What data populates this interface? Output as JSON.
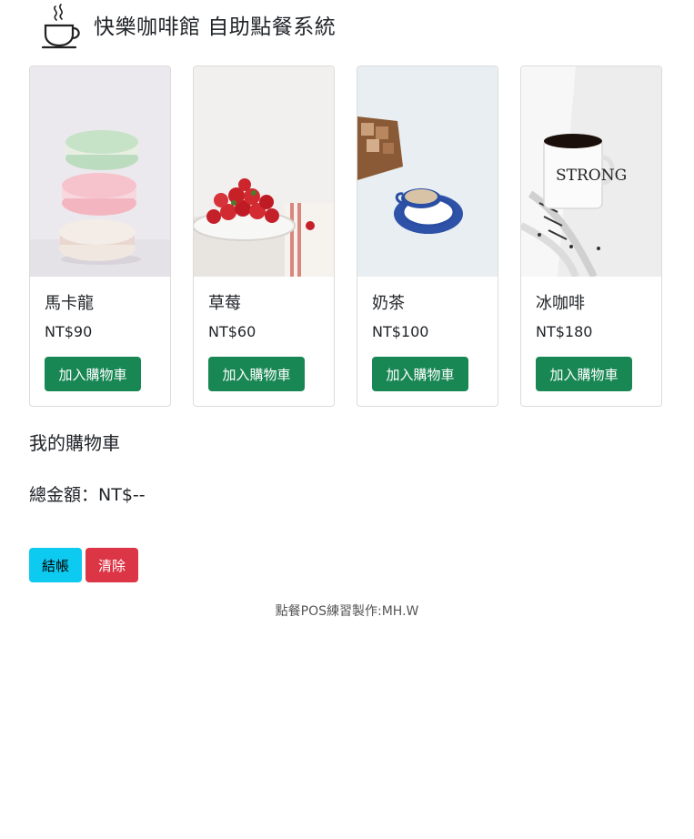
{
  "header": {
    "logo_icon": "coffee-cup-icon",
    "title": "快樂咖啡館 自助點餐系統"
  },
  "products": [
    {
      "name": "馬卡龍",
      "price": "NT$90",
      "button_label": "加入購物車",
      "image": "macaron-stack-photo"
    },
    {
      "name": "草莓",
      "price": "NT$60",
      "button_label": "加入購物車",
      "image": "strawberry-bowl-photo"
    },
    {
      "name": "奶茶",
      "price": "NT$100",
      "button_label": "加入購物車",
      "image": "milk-tea-cup-photo"
    },
    {
      "name": "冰咖啡",
      "price": "NT$180",
      "button_label": "加入購物車",
      "image": "coffee-mug-photo"
    }
  ],
  "cart": {
    "title": "我的購物車",
    "total": "總金額：NT$--"
  },
  "actions": {
    "checkout_label": "結帳",
    "clear_label": "清除"
  },
  "footer": {
    "text": "點餐POS練習製作:MH.W"
  },
  "colors": {
    "add_button": "#198754",
    "checkout_button": "#0dcaf0",
    "clear_button": "#dc3545",
    "card_border": "#dcdcdc"
  }
}
